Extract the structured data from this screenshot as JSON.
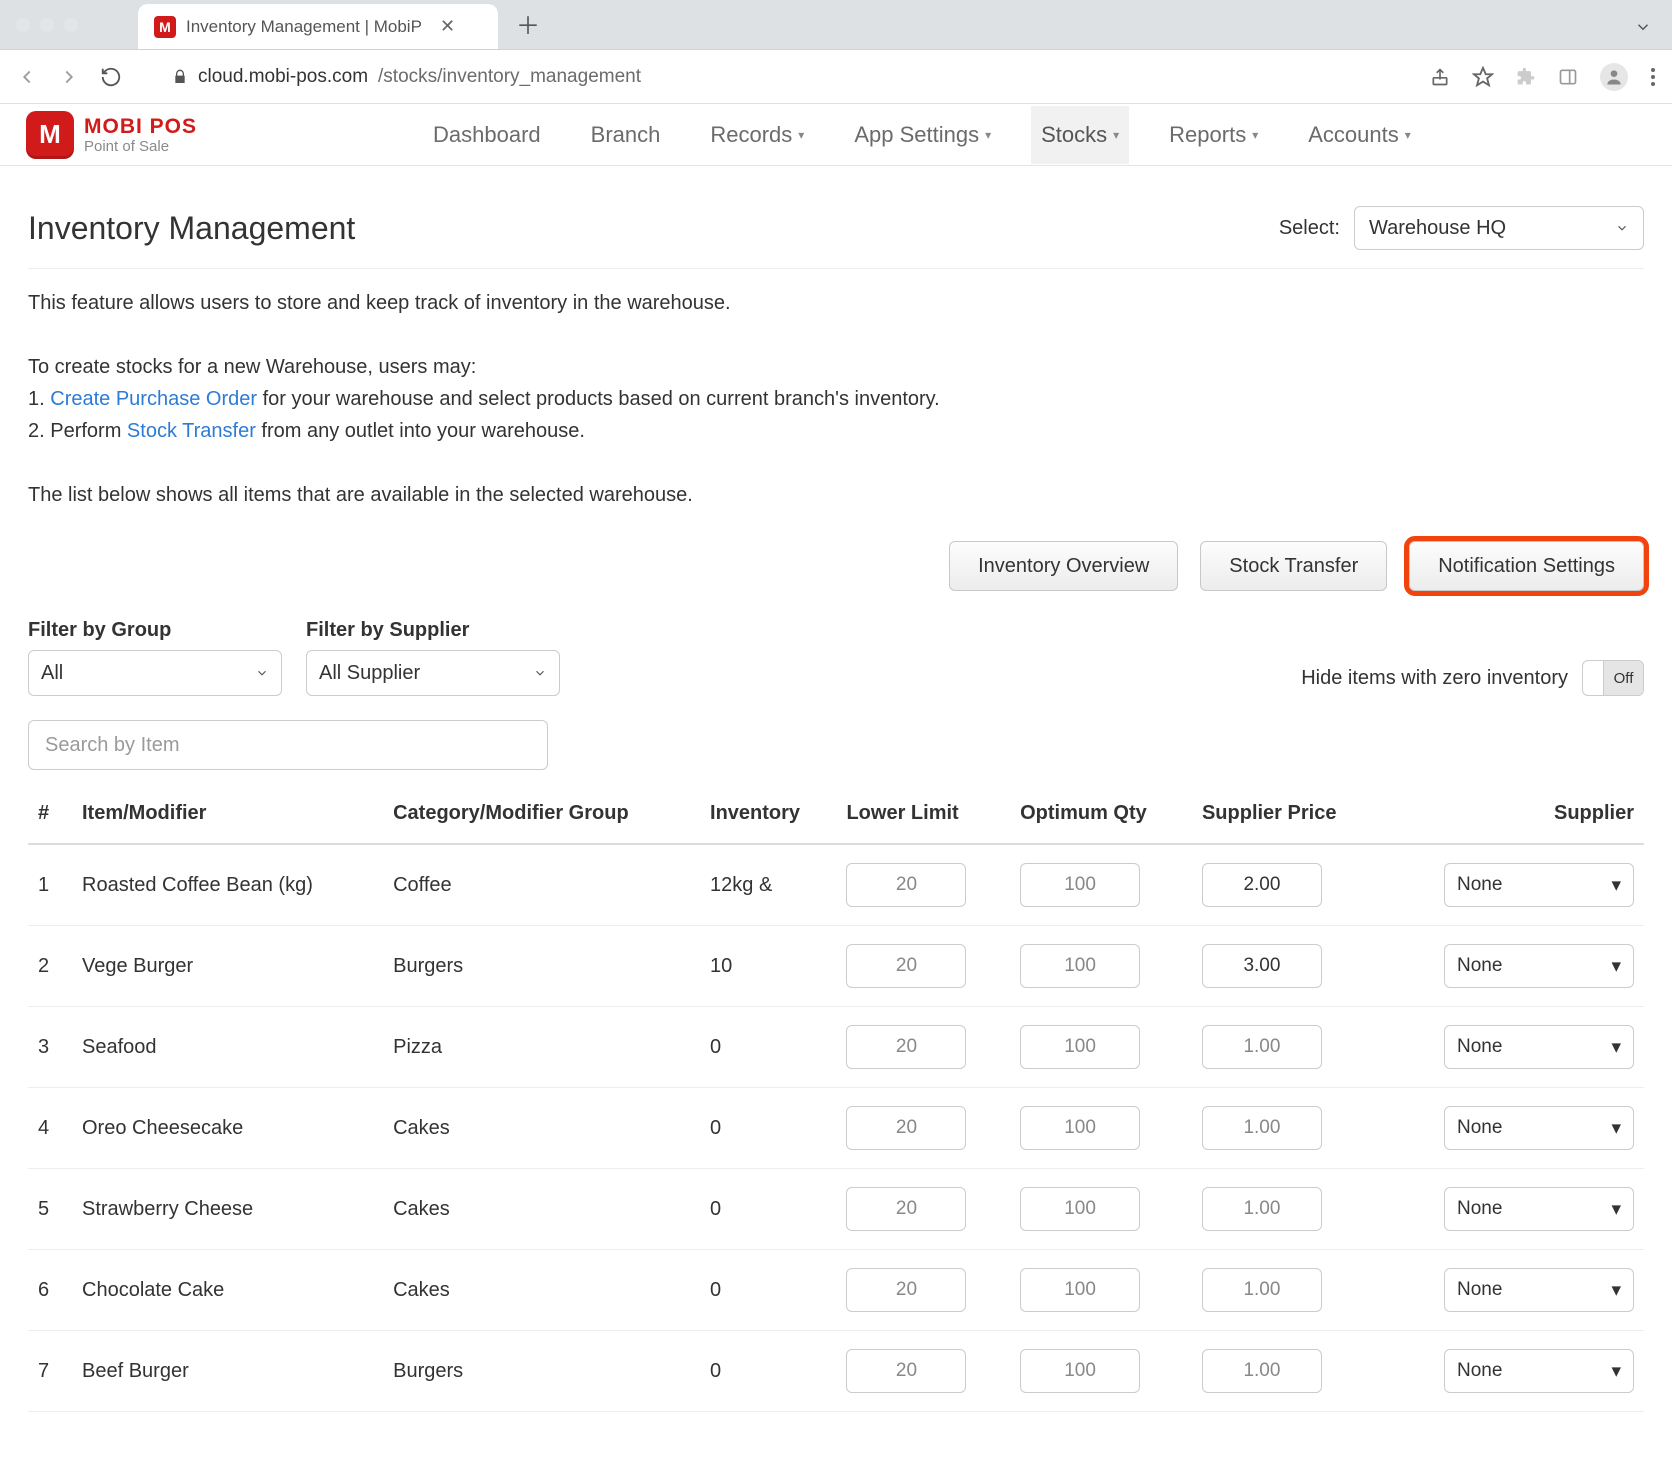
{
  "browser": {
    "tab_title": "Inventory Management | MobiP",
    "url_host": "cloud.mobi-pos.com",
    "url_path": "/stocks/inventory_management"
  },
  "brand": {
    "name": "MOBI POS",
    "tagline": "Point of Sale",
    "mark": "M"
  },
  "menu": {
    "items": [
      "Dashboard",
      "Branch",
      "Records",
      "App Settings",
      "Stocks",
      "Reports",
      "Accounts"
    ],
    "dropdown_flags": [
      false,
      false,
      true,
      true,
      true,
      true,
      true
    ],
    "active_index": 4
  },
  "page": {
    "title": "Inventory Management",
    "select_label": "Select:",
    "select_value": "Warehouse HQ",
    "intro_line1": "This feature allows users to store and keep track of inventory in the warehouse.",
    "intro_line2": "To create stocks for a new Warehouse, users may:",
    "intro_step1_pre": "1. ",
    "intro_step1_link": "Create Purchase Order",
    "intro_step1_post": " for your warehouse and select products based on current branch's inventory.",
    "intro_step2_pre": "2. Perform ",
    "intro_step2_link": "Stock Transfer",
    "intro_step2_post": " from any outlet into your warehouse.",
    "intro_line3": "The list below shows all items that are available in the selected warehouse."
  },
  "actions": {
    "inventory_overview": "Inventory Overview",
    "stock_transfer": "Stock Transfer",
    "notification_settings": "Notification Settings"
  },
  "filters": {
    "group_label": "Filter by Group",
    "group_value": "All",
    "supplier_label": "Filter by Supplier",
    "supplier_value": "All Supplier",
    "hide_zero_label": "Hide items with zero inventory",
    "hide_zero_state": "Off",
    "search_placeholder": "Search by Item"
  },
  "table": {
    "headers": [
      "#",
      "Item/Modifier",
      "Category/Modifier Group",
      "Inventory",
      "Lower Limit",
      "Optimum Qty",
      "Supplier Price",
      "Supplier"
    ],
    "rows": [
      {
        "n": "1",
        "item": "Roasted Coffee Bean (kg)",
        "cat": "Coffee",
        "inv": "12kg &",
        "low": "20",
        "opt": "100",
        "price": "2.00",
        "sup": "None",
        "price_dark": true
      },
      {
        "n": "2",
        "item": "Vege Burger",
        "cat": "Burgers",
        "inv": "10",
        "low": "20",
        "opt": "100",
        "price": "3.00",
        "sup": "None",
        "price_dark": true
      },
      {
        "n": "3",
        "item": "Seafood",
        "cat": "Pizza",
        "inv": "0",
        "low": "20",
        "opt": "100",
        "price": "1.00",
        "sup": "None",
        "price_dark": false
      },
      {
        "n": "4",
        "item": "Oreo Cheesecake",
        "cat": "Cakes",
        "inv": "0",
        "low": "20",
        "opt": "100",
        "price": "1.00",
        "sup": "None",
        "price_dark": false
      },
      {
        "n": "5",
        "item": "Strawberry Cheese",
        "cat": "Cakes",
        "inv": "0",
        "low": "20",
        "opt": "100",
        "price": "1.00",
        "sup": "None",
        "price_dark": false
      },
      {
        "n": "6",
        "item": "Chocolate Cake",
        "cat": "Cakes",
        "inv": "0",
        "low": "20",
        "opt": "100",
        "price": "1.00",
        "sup": "None",
        "price_dark": false
      },
      {
        "n": "7",
        "item": "Beef Burger",
        "cat": "Burgers",
        "inv": "0",
        "low": "20",
        "opt": "100",
        "price": "1.00",
        "sup": "None",
        "price_dark": false
      }
    ]
  }
}
